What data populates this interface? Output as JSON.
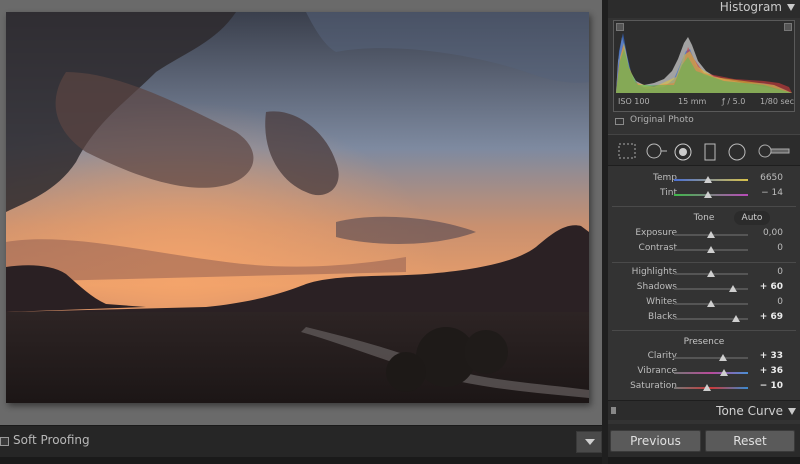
{
  "toolbar": {
    "soft_proofing_label": "Soft Proofing"
  },
  "histogram": {
    "title": "Histogram",
    "iso": "ISO 100",
    "focal": "15 mm",
    "aperture": "ƒ / 5.0",
    "shutter": "1/80 sec",
    "original_photo_label": "Original Photo"
  },
  "basic": {
    "temp": {
      "label": "Temp",
      "value": "6650",
      "pos": 0.46
    },
    "tint": {
      "label": "Tint",
      "value": "− 14",
      "pos": 0.46
    },
    "tone_title": "Tone",
    "auto_label": "Auto",
    "exposure": {
      "label": "Exposure",
      "value": "0,00",
      "pos": 0.5
    },
    "contrast": {
      "label": "Contrast",
      "value": "0",
      "pos": 0.5
    },
    "highlights": {
      "label": "Highlights",
      "value": "0",
      "pos": 0.5
    },
    "shadows": {
      "label": "Shadows",
      "value": "+ 60",
      "pos": 0.8
    },
    "whites": {
      "label": "Whites",
      "value": "0",
      "pos": 0.5
    },
    "blacks": {
      "label": "Blacks",
      "value": "+ 69",
      "pos": 0.84
    },
    "presence_title": "Presence",
    "clarity": {
      "label": "Clarity",
      "value": "+ 33",
      "pos": 0.66
    },
    "vibrance": {
      "label": "Vibrance",
      "value": "+ 36",
      "pos": 0.68
    },
    "saturation": {
      "label": "Saturation",
      "value": "− 10",
      "pos": 0.45
    }
  },
  "tone_curve": {
    "title": "Tone Curve"
  },
  "buttons": {
    "previous": "Previous",
    "reset": "Reset"
  },
  "colors": {
    "panel_bg": "#333333",
    "canvas_bg": "#6a6a6a",
    "slider_knob": "#cfcfcf"
  },
  "icons": [
    "crop-overlay-icon",
    "spot-removal-icon",
    "red-eye-icon",
    "graduated-filter-icon",
    "radial-filter-icon",
    "adjustment-brush-icon",
    "chevron-down-icon"
  ]
}
